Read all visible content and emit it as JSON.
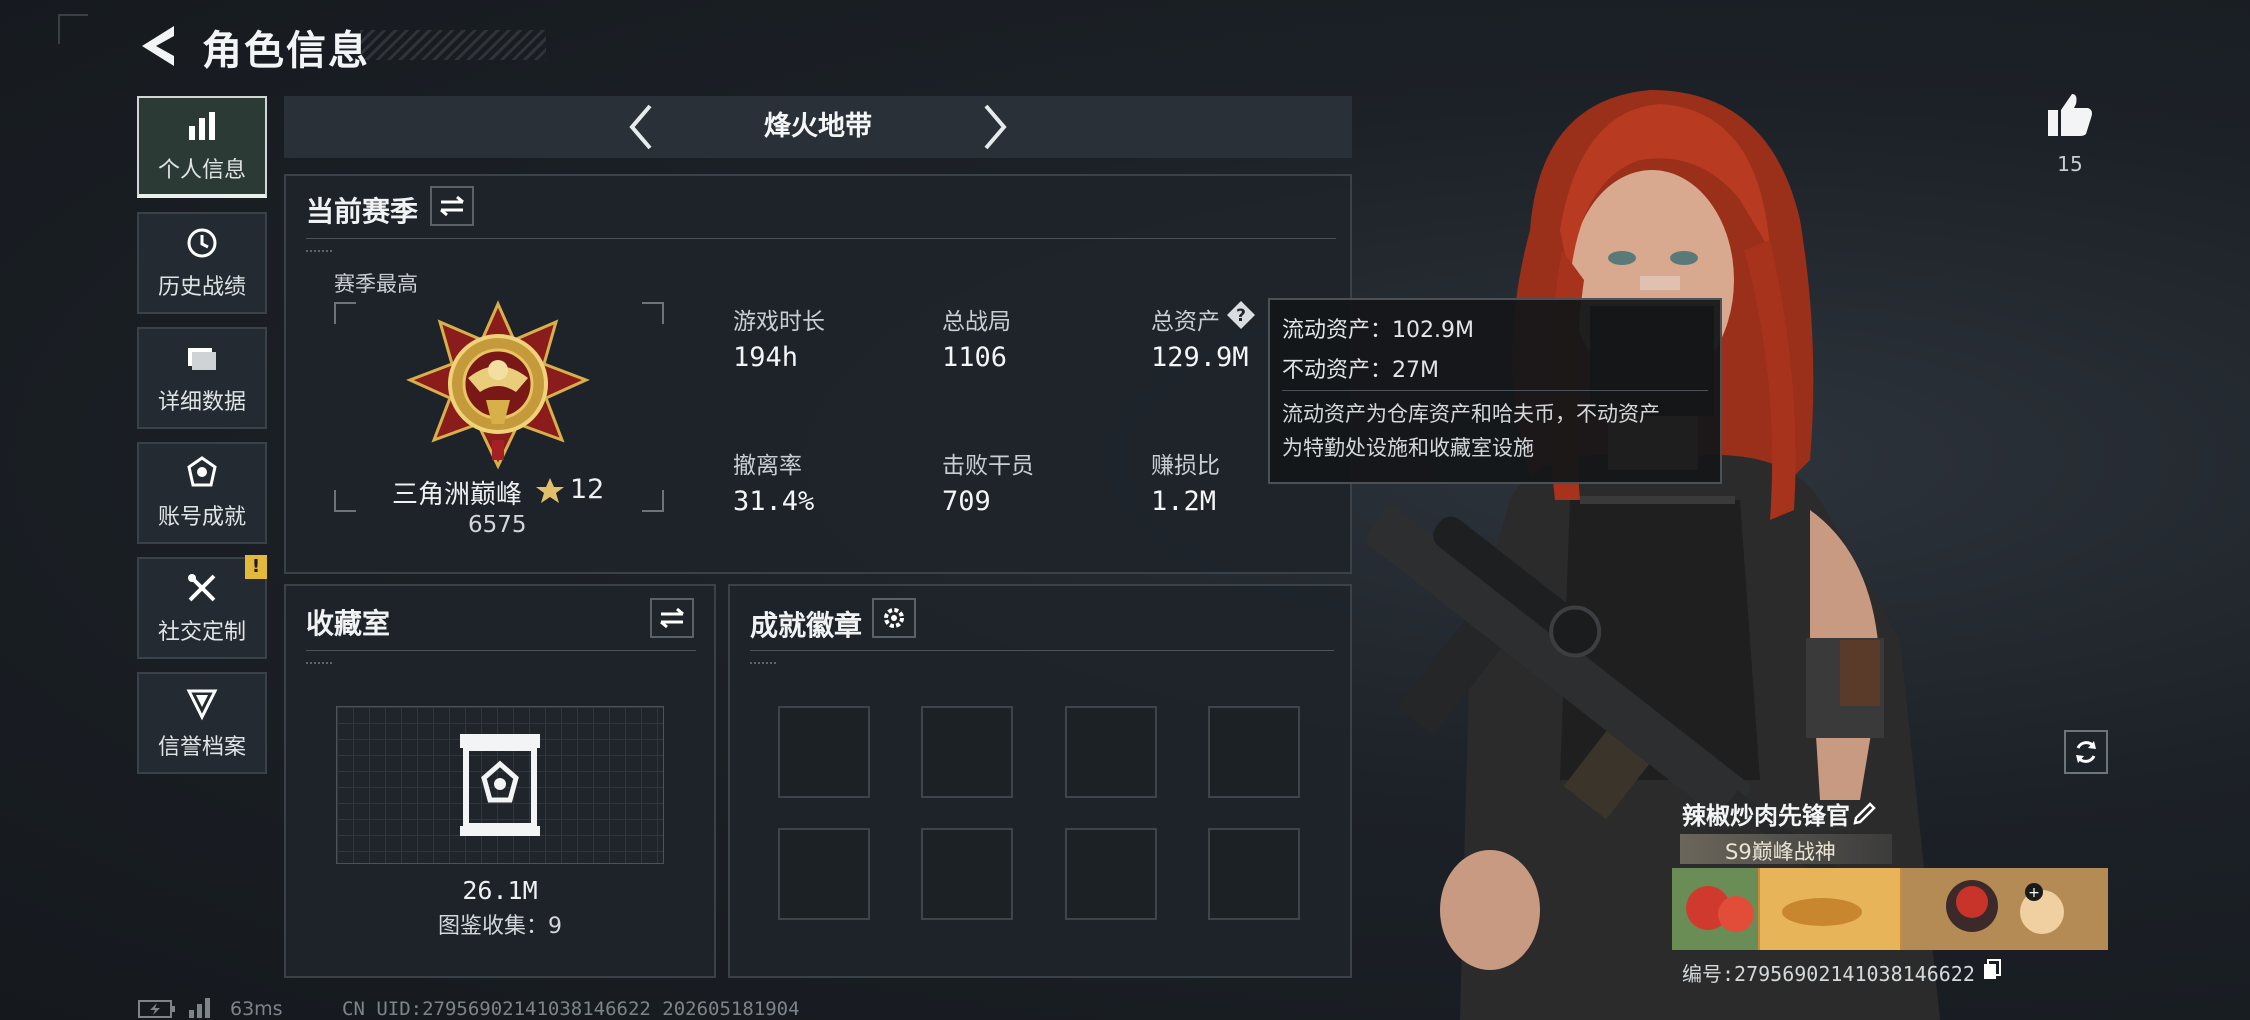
{
  "header": {
    "title": "角色信息"
  },
  "sidebar": {
    "items": [
      {
        "label": "个人信息",
        "icon": "bar-chart-icon",
        "active": true
      },
      {
        "label": "历史战绩",
        "icon": "history-icon"
      },
      {
        "label": "详细数据",
        "icon": "folder-icon"
      },
      {
        "label": "账号成就",
        "icon": "achievement-icon"
      },
      {
        "label": "社交定制",
        "icon": "tools-icon",
        "badge": "!"
      },
      {
        "label": "信誉档案",
        "icon": "shield-icon"
      }
    ]
  },
  "mode": {
    "title": "烽火地带"
  },
  "season": {
    "title": "当前赛季",
    "best_label": "赛季最高",
    "rank_name": "三角洲巅峰",
    "rank_stars": "12",
    "rank_score": "6575",
    "stats": [
      {
        "label": "游戏时长",
        "value": "194h"
      },
      {
        "label": "总战局",
        "value": "1106"
      },
      {
        "label": "总资产",
        "value": "129.9M"
      },
      {
        "label": "撤离率",
        "value": "31.4%"
      },
      {
        "label": "击败干员",
        "value": "709"
      },
      {
        "label": "赚损比",
        "value": "1.2M"
      }
    ]
  },
  "tooltip": {
    "liquid": "流动资产：102.9M",
    "fixed": "不动资产：27M",
    "desc_line1": "流动资产为仓库资产和哈夫币，不动资产",
    "desc_line2": "为特勤处设施和收藏室设施"
  },
  "collection": {
    "title": "收藏室",
    "value": "26.1M",
    "count_label": "图鉴收集：9"
  },
  "badges": {
    "title": "成就徽章",
    "slot_count": 8
  },
  "player": {
    "likes": "15",
    "name": "辣椒炒肉先锋官",
    "title": "S9巅峰战神",
    "id": "编号:2795690214103814662​2"
  },
  "footer": {
    "ping": "63ms",
    "uid": "CN UID:27956902141038146622  202605181904"
  },
  "colors": {
    "accent_active": "#2b3a35",
    "panel_bg": "#1e242a",
    "badge_yellow": "#e3b93b",
    "hair_red": "#b83a20"
  }
}
